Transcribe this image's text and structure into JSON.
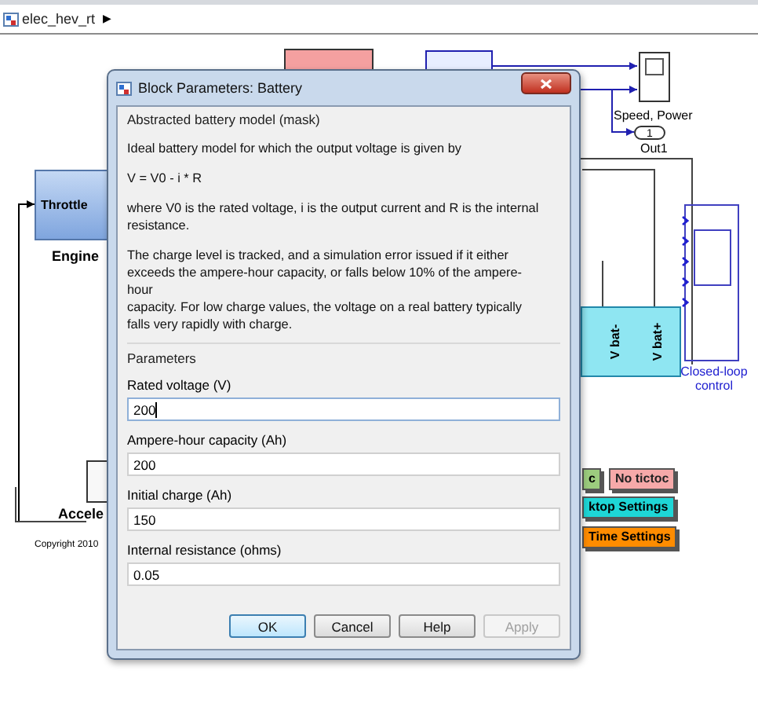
{
  "model_bar": {
    "title": "elec_hev_rt",
    "arrow": "▶"
  },
  "diagram": {
    "scope_label": "Speed, Power",
    "outport_number": "1",
    "outport_label": "Out1",
    "engine_port": "Throttle",
    "engine_label": "Engine",
    "accel_label": "Accele",
    "copyright": "Copyright 2010",
    "battery_ports": [
      "V bat-",
      "V bat+"
    ],
    "controller_label": "Closed-loop control",
    "tags": [
      {
        "label": "c",
        "color": "#9ccc7e"
      },
      {
        "label": "No tictoc",
        "color": "#f6a9a9"
      },
      {
        "label": "ktop Settings",
        "color": "#1ed6d6"
      },
      {
        "label": "Time Settings",
        "color": "#ff8c00"
      }
    ]
  },
  "dialog": {
    "title": "Block Parameters: Battery",
    "mask_title": "Abstracted battery model (mask)",
    "description": [
      "Ideal battery model for which the output voltage is given by",
      "V = V0 - i * R",
      "where V0 is the rated voltage, i is the output current and R is the internal\nresistance.",
      "The charge level is tracked, and a simulation error issued if it either\nexceeds the ampere-hour capacity, or falls below 10% of the ampere-\nhour\ncapacity. For low charge values, the voltage on a real battery typically\nfalls very rapidly with charge."
    ],
    "parameters_title": "Parameters",
    "fields": [
      {
        "label": "Rated voltage (V)",
        "value": "200",
        "focused": true
      },
      {
        "label": "Ampere-hour capacity (Ah)",
        "value": "200",
        "focused": false
      },
      {
        "label": "Initial charge (Ah)",
        "value": "150",
        "focused": false
      },
      {
        "label": "Internal resistance (ohms)",
        "value": "0.05",
        "focused": false
      }
    ],
    "buttons": [
      {
        "label": "OK",
        "default": true,
        "disabled": false
      },
      {
        "label": "Cancel",
        "default": false,
        "disabled": false
      },
      {
        "label": "Help",
        "default": false,
        "disabled": false
      },
      {
        "label": "Apply",
        "default": false,
        "disabled": true
      }
    ]
  }
}
